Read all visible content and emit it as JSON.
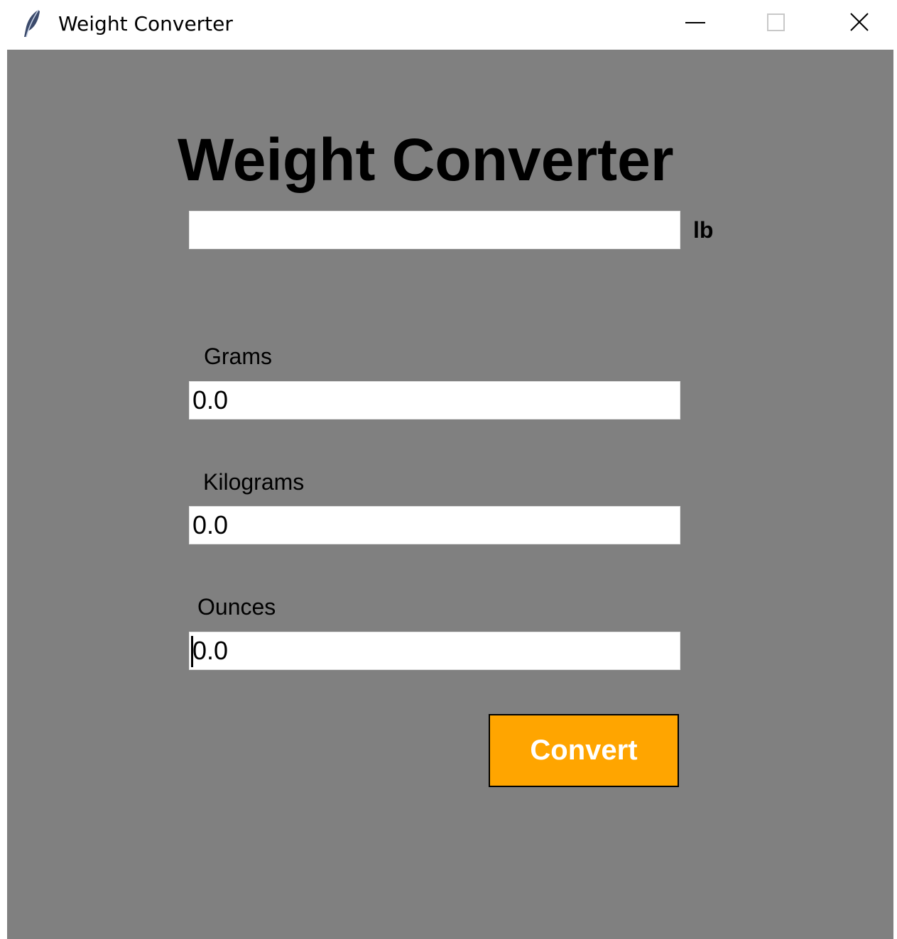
{
  "window": {
    "title": "Weight Converter",
    "icon": "feather-icon",
    "controls": [
      "minimize-icon",
      "maximize-icon",
      "close-icon"
    ]
  },
  "app": {
    "heading": "Weight Converter",
    "input": {
      "value": "",
      "unit": "lb"
    },
    "fields": [
      {
        "label": "Grams",
        "value": "0.0"
      },
      {
        "label": "Kilograms",
        "value": "0.0"
      },
      {
        "label": "Ounces",
        "value": "0.0"
      }
    ],
    "convert_label": "Convert"
  },
  "colors": {
    "background": "#808080",
    "button": "#ffa500",
    "button_text": "#ffffff"
  }
}
